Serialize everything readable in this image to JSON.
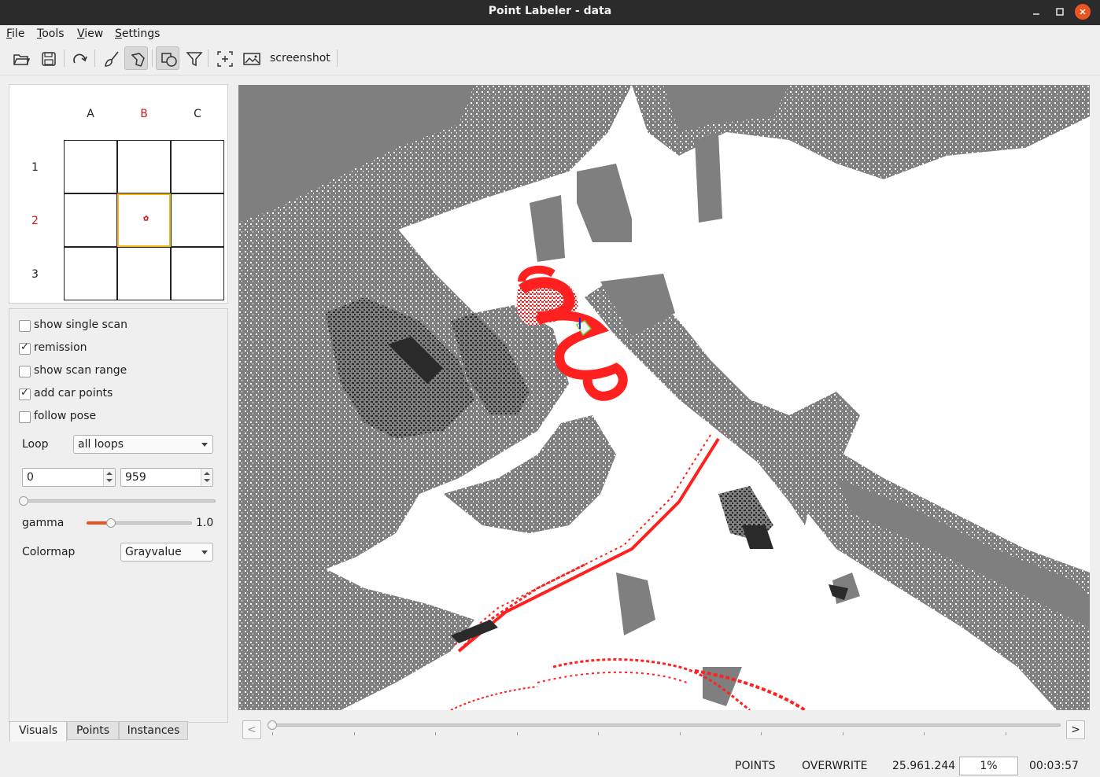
{
  "window": {
    "title": "Point Labeler - data"
  },
  "menu": [
    {
      "label": "File",
      "mnemonic": "F",
      "rest": "ile"
    },
    {
      "label": "Tools",
      "mnemonic": "T",
      "rest": "ools"
    },
    {
      "label": "View",
      "mnemonic": "V",
      "rest": "iew"
    },
    {
      "label": "Settings",
      "mnemonic": "S",
      "rest": "ettings"
    }
  ],
  "toolbar": {
    "icons": [
      "open-folder-icon",
      "save-icon",
      "redo-icon",
      "brush-icon",
      "polygon-icon",
      "shapes-icon",
      "filter-icon",
      "center-view-icon",
      "screenshot-icon"
    ],
    "screenshot_label": "screenshot"
  },
  "tile_grid": {
    "columns": [
      "A",
      "B",
      "C"
    ],
    "rows": [
      "1",
      "2",
      "3"
    ],
    "selected_column": "B",
    "selected_row": "2",
    "highlight_color": "#d01c1c",
    "selection_color": "#f2b71c"
  },
  "visuals": {
    "checkboxes": [
      {
        "label": "show single scan",
        "checked": false
      },
      {
        "label": "remission",
        "checked": true
      },
      {
        "label": "show scan range",
        "checked": false
      },
      {
        "label": "add car points",
        "checked": true
      },
      {
        "label": "follow pose",
        "checked": false
      }
    ],
    "loop": {
      "label": "Loop",
      "value": "all loops"
    },
    "range": {
      "start": "0",
      "end": "959",
      "slider_fraction": 0.0
    },
    "gamma": {
      "label": "gamma",
      "value": "1.0",
      "slider_fraction": 0.24
    },
    "colormap": {
      "label": "Colormap",
      "value": "Grayvalue"
    }
  },
  "tabs": [
    {
      "label": "Visuals",
      "active": true
    },
    {
      "label": "Points",
      "active": false
    },
    {
      "label": "Instances",
      "active": false
    }
  ],
  "timeline": {
    "prev_label": "<",
    "next_label": ">",
    "position_fraction": 0.0
  },
  "status": {
    "mode": "POINTS",
    "overwrite": "OVERWRITE",
    "point_count": "25.961.244",
    "percent": "1%",
    "time": "00:03:57"
  },
  "colors": {
    "point_gray": "#7f7f7f",
    "point_dark": "#2a2a2a",
    "label_red": "#ff2020",
    "accent": "#e95420"
  }
}
